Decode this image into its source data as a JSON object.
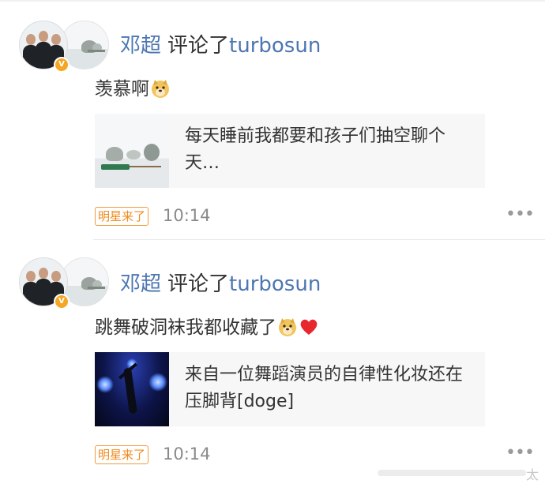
{
  "comments": [
    {
      "author": "邓超",
      "action": "评论了",
      "target": "turbosun",
      "text": "羡慕啊",
      "emojis": [
        "doge-emoji"
      ],
      "card": {
        "text": "每天睡前我都要和孩子们抽空聊个天…",
        "thumb": "snow-scene"
      },
      "tag": "明星来了",
      "time": "10:14",
      "more": "•••"
    },
    {
      "author": "邓超",
      "action": "评论了",
      "target": "turbosun",
      "text": "跳舞破洞袜我都收藏了",
      "emojis": [
        "doge-emoji",
        "heart-emoji"
      ],
      "card": {
        "text": "来自一位舞蹈演员的自律性化妆还在压脚背[doge]",
        "thumb": "stage-dancer"
      },
      "tag": "明星来了",
      "time": "10:14",
      "more": "•••"
    }
  ],
  "footer": {
    "tail_text": "太"
  },
  "colors": {
    "link": "#4d76b2",
    "text": "#333333",
    "tag": "#f08a1c",
    "time": "#8a8a8a",
    "card_bg": "#f7f7f7",
    "verified": "#f5a623"
  }
}
